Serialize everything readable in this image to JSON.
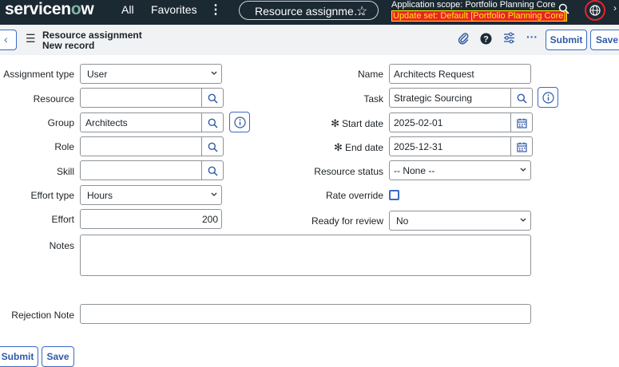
{
  "nav": {
    "logo_a": "servicen",
    "logo_o": "o",
    "logo_b": "w",
    "all": "All",
    "favorites": "Favorites",
    "more": "⋮",
    "pill_title": "Resource assignme…",
    "scope_line1": "Application scope: Portfolio Planning Core",
    "scope_line2": "Update set: Default [Portfolio Planning Core]"
  },
  "header": {
    "title_line1": "Resource assignment",
    "title_line2": "New record",
    "submit_label": "Submit",
    "save_label": "Save",
    "more_label": "···"
  },
  "form": {
    "assignment_type": {
      "label": "Assignment type",
      "value": "User"
    },
    "resource": {
      "label": "Resource",
      "value": ""
    },
    "group": {
      "label": "Group",
      "value": "Architects"
    },
    "role": {
      "label": "Role",
      "value": ""
    },
    "skill": {
      "label": "Skill",
      "value": ""
    },
    "effort_type": {
      "label": "Effort type",
      "value": "Hours"
    },
    "effort": {
      "label": "Effort",
      "value": "200"
    },
    "notes": {
      "label": "Notes",
      "value": ""
    },
    "name": {
      "label": "Name",
      "value": "Architects Request"
    },
    "task": {
      "label": "Task",
      "value": "Strategic Sourcing"
    },
    "start_date": {
      "label": "Start date",
      "value": "2025-02-01",
      "required_mark": "✻"
    },
    "end_date": {
      "label": "End date",
      "value": "2025-12-31",
      "required_mark": "✻"
    },
    "resource_status": {
      "label": "Resource status",
      "value": "-- None --"
    },
    "rate_override": {
      "label": "Rate override",
      "checked": false
    },
    "ready_for_review": {
      "label": "Ready for review",
      "value": "No"
    },
    "rejection_note": {
      "label": "Rejection Note",
      "value": ""
    }
  },
  "footer": {
    "submit_label": "Submit",
    "save_label": "Save"
  },
  "colors": {
    "nav_bg": "#1b2933",
    "accent": "#3b6ac4",
    "update_set_bg": "#e8232b",
    "update_set_text": "#fff200"
  }
}
